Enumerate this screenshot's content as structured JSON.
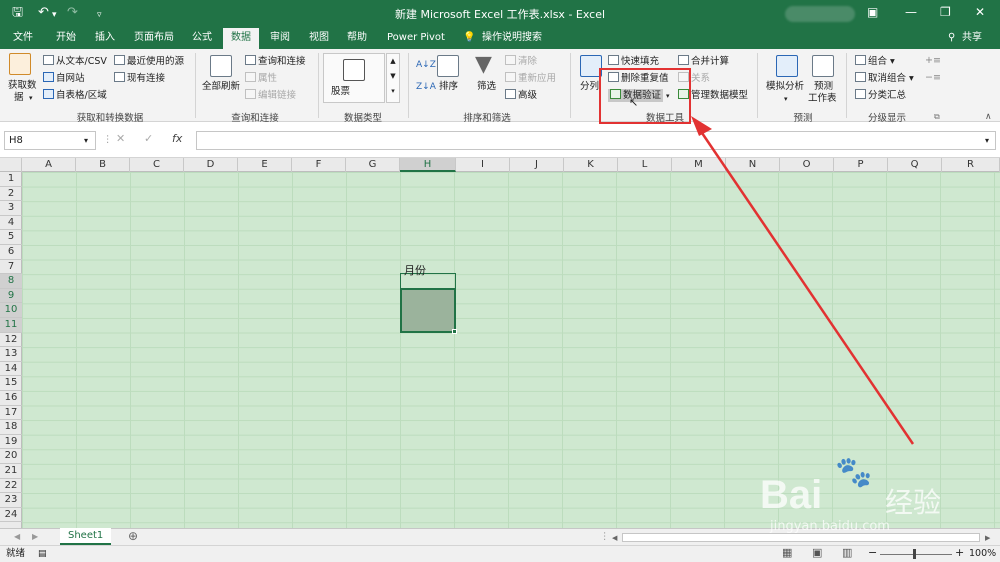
{
  "titlebar": {
    "title": "新建 Microsoft Excel 工作表.xlsx - Excel",
    "icons": [
      "save-icon",
      "undo-icon",
      "redo-icon",
      "customize-quick-access-icon"
    ],
    "window_buttons": [
      "ribbon-display-icon",
      "minimize-icon",
      "restore-icon",
      "close-icon"
    ]
  },
  "tabs": [
    {
      "label": "文件"
    },
    {
      "label": "开始"
    },
    {
      "label": "插入"
    },
    {
      "label": "页面布局"
    },
    {
      "label": "公式"
    },
    {
      "label": "数据",
      "active": true
    },
    {
      "label": "审阅"
    },
    {
      "label": "视图"
    },
    {
      "label": "帮助"
    },
    {
      "label": "Power Pivot"
    },
    {
      "label": "操作说明搜索"
    }
  ],
  "share_label": "共享",
  "ribbon": {
    "get_data": {
      "label_line1": "获取数",
      "label_line2": "据"
    },
    "from_text_csv": "从文本/CSV",
    "from_web": "自网站",
    "from_table": "自表格/区域",
    "recent_sources": "最近使用的源",
    "existing_connections": "现有连接",
    "group_get_transform": "获取和转换数据",
    "refresh_all": "全部刷新",
    "queries_connections": "查询和连接",
    "properties": "属性",
    "edit_links": "编辑链接",
    "group_queries": "查询和连接",
    "stocks": "股票",
    "group_datatypes": "数据类型",
    "sort": "排序",
    "filter": "筛选",
    "clear": "清除",
    "reapply": "重新应用",
    "advanced": "高级",
    "group_sortfilter": "排序和筛选",
    "text_to_columns": "分列",
    "flash_fill": "快速填充",
    "remove_duplicates": "删除重复值",
    "data_validation": "数据验证",
    "consolidate": "合并计算",
    "relationships": "关系",
    "manage_data_model": "管理数据模型",
    "group_datatools": "数据工具",
    "what_if": "模拟分析",
    "forecast_line1": "预测",
    "forecast_line2": "工作表",
    "group_forecast": "预测",
    "group": "组合",
    "ungroup": "取消组合",
    "subtotal": "分类汇总",
    "group_outline": "分级显示"
  },
  "formula_bar": {
    "name_box": "H8",
    "value": ""
  },
  "grid": {
    "columns": [
      "A",
      "B",
      "C",
      "D",
      "E",
      "F",
      "G",
      "H",
      "I",
      "J",
      "K",
      "L",
      "M",
      "N",
      "O",
      "P",
      "Q",
      "R"
    ],
    "rows": [
      "1",
      "2",
      "3",
      "4",
      "5",
      "6",
      "7",
      "8",
      "9",
      "10",
      "11",
      "12",
      "13",
      "14",
      "15",
      "16",
      "17",
      "18",
      "19",
      "20",
      "21",
      "22",
      "23",
      "24"
    ],
    "selected_column": "H",
    "selected_rows": [
      "8",
      "9",
      "10",
      "11"
    ],
    "cell_H7": "月份"
  },
  "sheet_tab": "Sheet1",
  "status": {
    "ready": "就绪",
    "zoom": "100%"
  },
  "watermark": {
    "brand": "Bai",
    "brand_suffix": "经验",
    "url": "jingyan.baidu.com"
  }
}
